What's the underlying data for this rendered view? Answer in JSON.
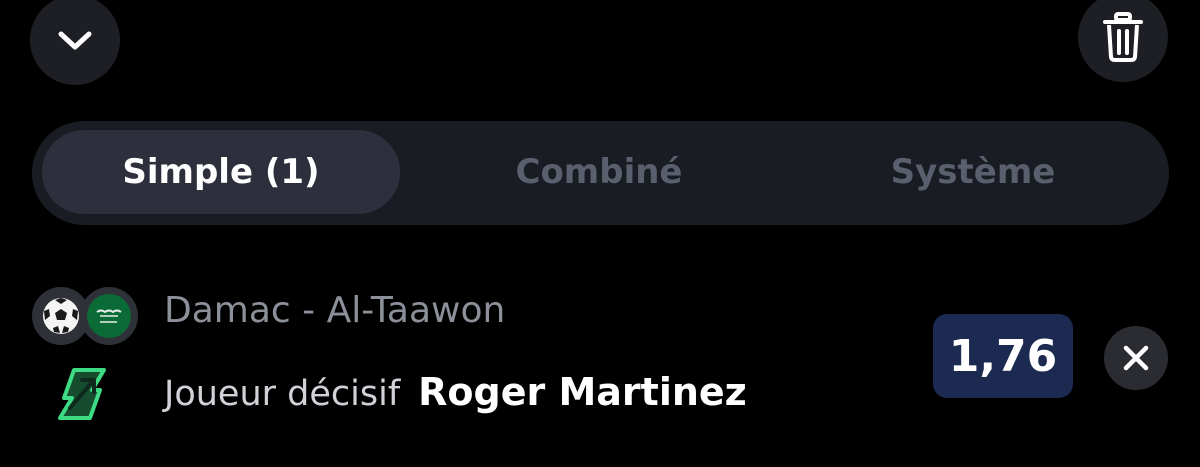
{
  "header": {
    "collapse_icon": "chevron-down-icon",
    "trash_icon": "trash-icon"
  },
  "tabs": [
    {
      "label": "Simple (1)",
      "active": true
    },
    {
      "label": "Combiné",
      "active": false
    },
    {
      "label": "Système",
      "active": false
    }
  ],
  "bet": {
    "sport_icon": "soccer-ball-icon",
    "league_icon": "saudi-flag-icon",
    "match": "Damac - Al-Taawon",
    "boost_icon": "boost-arrow-icon",
    "market": "Joueur décisif",
    "selection": "Roger Martinez",
    "odds": "1,76",
    "remove_icon": "close-icon"
  },
  "colors": {
    "background": "#000000",
    "tab_bar": "#1a1c24",
    "active_tab": "#2d303c",
    "odds_bg": "#1c2a52",
    "boost_green": "#3ddc84"
  }
}
